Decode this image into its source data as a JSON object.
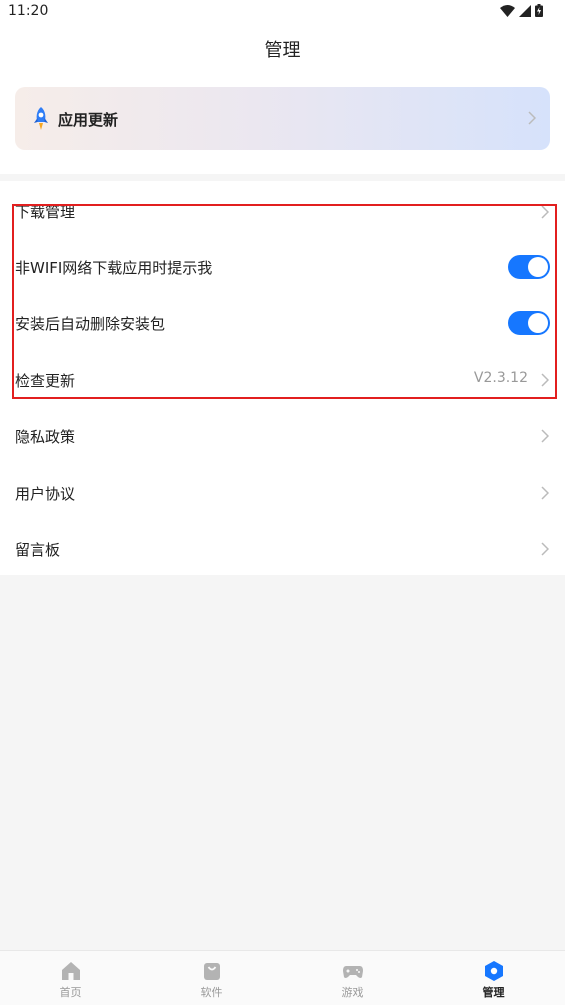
{
  "status_bar": {
    "time": "11:20"
  },
  "header": {
    "title": "管理"
  },
  "update_card": {
    "label": "应用更新"
  },
  "settings": {
    "download_management": "下载管理",
    "non_wifi_prompt": "非WIFI网络下载应用时提示我",
    "non_wifi_prompt_enabled": true,
    "auto_delete_package": "安装后自动删除安装包",
    "auto_delete_package_enabled": true,
    "check_update": "检查更新",
    "version": "V2.3.12",
    "privacy_policy": "隐私政策",
    "user_agreement": "用户协议",
    "message_board": "留言板"
  },
  "tabbar": {
    "items": [
      {
        "label": "首页",
        "icon": "home-icon"
      },
      {
        "label": "软件",
        "icon": "shopping-bag-icon"
      },
      {
        "label": "游戏",
        "icon": "gamepad-icon"
      },
      {
        "label": "管理",
        "icon": "manage-hexagon-icon"
      }
    ],
    "active_index": 3
  },
  "colors": {
    "accent": "#1677ff",
    "highlight": "#e21f1f"
  }
}
